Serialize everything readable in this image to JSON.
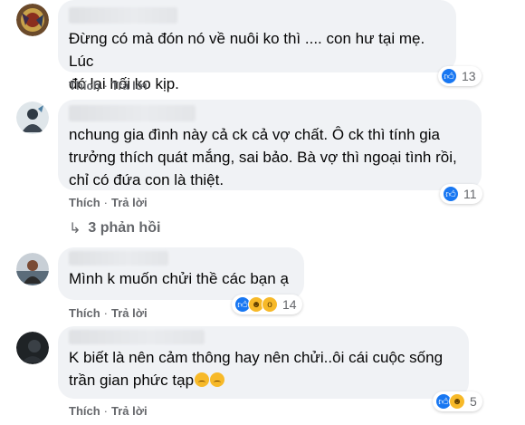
{
  "action_labels": {
    "like": "Thích",
    "reply": "Trả lời",
    "separator": "·"
  },
  "comments": [
    {
      "text": "Đừng có mà đón nó về nuôi ko thì .... con hư tại mẹ. Lúc\nđó lại hối ko kịp.",
      "reactions": [
        "like-icon"
      ],
      "reaction_count": "13"
    },
    {
      "text": "nchung gia đình này cả ck cả vợ chất. Ô ck thì tính gia\ntrưởng thích quát mắng, sai bảo. Bà vợ thì ngoại tình rồi,\nchỉ có đứa con là thiệt.",
      "reactions": [
        "like-icon"
      ],
      "reaction_count": "11",
      "replies_label": "3 phản hồi"
    },
    {
      "text": "Mình k muốn chửi thề các bạn ạ",
      "reactions": [
        "like-icon",
        "haha-icon",
        "wow-icon"
      ],
      "reaction_count": "14"
    },
    {
      "text": "K biết là nên cảm thông hay nên chửi..ôi cái cuộc sống\ntrần gian phức tạp",
      "reactions": [
        "like-icon",
        "haha-icon"
      ],
      "reaction_count": "5"
    }
  ],
  "colors": {
    "bubble": "#f0f2f5",
    "like": "#1877f2",
    "secondary_text": "#65676b"
  }
}
